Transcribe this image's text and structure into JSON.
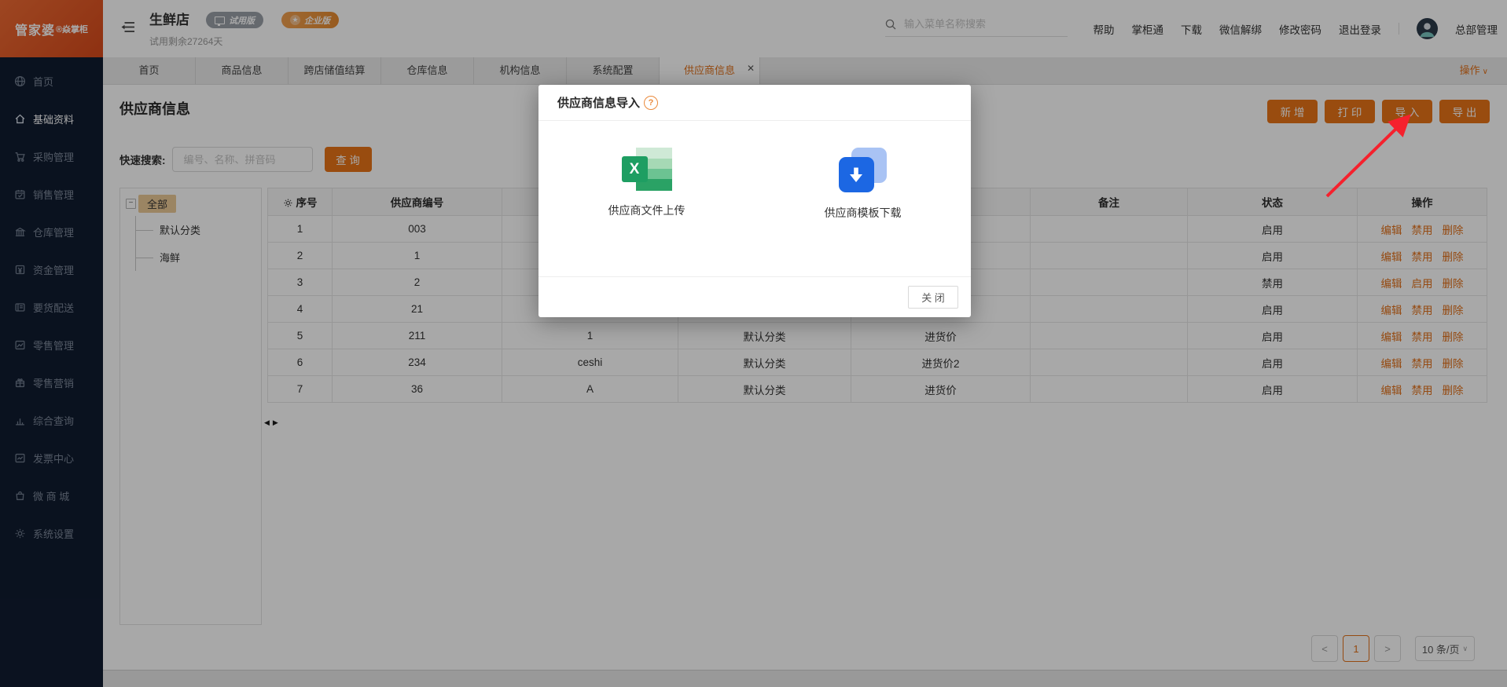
{
  "colors": {
    "accent_orange": "#e2711a",
    "button_orange": "#e87418",
    "sidebar_bg": "#101c30",
    "logo_orange": "#e05a24",
    "excel_green": "#1e9e62",
    "download_blue": "#1c67e3",
    "arrow_red": "#f5212d",
    "tree_highlight": "#ecca96"
  },
  "logo": {
    "brand": "管家婆",
    "product": "®焱掌柜"
  },
  "topbar": {
    "store_name": "生鲜店",
    "trial_badge": "试用版",
    "enterprise_badge": "企业版",
    "trial_remaining": "试用剩余27264天",
    "search_placeholder": "输入菜单名称搜索",
    "links": [
      {
        "label": "帮助"
      },
      {
        "label": "掌柜通"
      },
      {
        "label": "下载"
      },
      {
        "label": "微信解绑"
      },
      {
        "label": "修改密码"
      },
      {
        "label": "退出登录"
      }
    ],
    "user_name": "总部管理"
  },
  "sidebar": {
    "items": [
      {
        "label": "首页",
        "icon": "globe-icon"
      },
      {
        "label": "基础资料",
        "icon": "home-icon",
        "active": true
      },
      {
        "label": "采购管理",
        "icon": "cart-icon"
      },
      {
        "label": "销售管理",
        "icon": "calendar-icon"
      },
      {
        "label": "仓库管理",
        "icon": "warehouse-icon"
      },
      {
        "label": "资金管理",
        "icon": "money-icon"
      },
      {
        "label": "要货配送",
        "icon": "delivery-icon"
      },
      {
        "label": "零售管理",
        "icon": "retail-chart-icon"
      },
      {
        "label": "零售营销",
        "icon": "gift-icon"
      },
      {
        "label": "综合查询",
        "icon": "bar-chart-icon"
      },
      {
        "label": "发票中心",
        "icon": "invoice-icon"
      },
      {
        "label": "微 商 城",
        "icon": "mall-icon"
      },
      {
        "label": "系统设置",
        "icon": "gear-icon"
      }
    ]
  },
  "tabs": {
    "items": [
      {
        "label": "首页"
      },
      {
        "label": "商品信息"
      },
      {
        "label": "跨店储值结算"
      },
      {
        "label": "仓库信息"
      },
      {
        "label": "机构信息"
      },
      {
        "label": "系统配置"
      },
      {
        "label": "供应商信息",
        "active": true
      }
    ],
    "more_label": "操作"
  },
  "page": {
    "title": "供应商信息",
    "action_buttons": [
      {
        "label": "新 增"
      },
      {
        "label": "打 印"
      },
      {
        "label": "导 入"
      },
      {
        "label": "导 出"
      }
    ],
    "quick_search": {
      "label": "快速搜索:",
      "placeholder": "编号、名称、拼音码",
      "query_label": "查 询"
    },
    "tree": {
      "root": "全部",
      "children": [
        {
          "label": "默认分类"
        },
        {
          "label": "海鲜"
        }
      ]
    },
    "table": {
      "columns": [
        "序号",
        "供应商编号",
        "",
        "",
        "",
        "备注",
        "状态",
        "操作"
      ],
      "rows": [
        {
          "seq": "1",
          "code": "003",
          "name": "",
          "category": "",
          "price": "",
          "note": "",
          "status": "启用",
          "actions": [
            {
              "label": "编辑"
            },
            {
              "label": "禁用"
            },
            {
              "label": "删除"
            }
          ]
        },
        {
          "seq": "2",
          "code": "1",
          "name": "",
          "category": "",
          "price": "",
          "note": "",
          "status": "启用",
          "actions": [
            {
              "label": "编辑"
            },
            {
              "label": "禁用"
            },
            {
              "label": "删除"
            }
          ]
        },
        {
          "seq": "3",
          "code": "2",
          "name": "",
          "category": "",
          "price": "",
          "note": "",
          "status": "禁用",
          "actions": [
            {
              "label": "编辑"
            },
            {
              "label": "启用"
            },
            {
              "label": "删除"
            }
          ]
        },
        {
          "seq": "4",
          "code": "21",
          "name": "",
          "category": "",
          "price": "",
          "note": "",
          "status": "启用",
          "actions": [
            {
              "label": "编辑"
            },
            {
              "label": "禁用"
            },
            {
              "label": "删除"
            }
          ]
        },
        {
          "seq": "5",
          "code": "211",
          "name": "1",
          "category": "默认分类",
          "price": "进货价",
          "note": "",
          "status": "启用",
          "actions": [
            {
              "label": "编辑"
            },
            {
              "label": "禁用"
            },
            {
              "label": "删除"
            }
          ]
        },
        {
          "seq": "6",
          "code": "234",
          "name": "ceshi",
          "category": "默认分类",
          "price": "进货价2",
          "note": "",
          "status": "启用",
          "actions": [
            {
              "label": "编辑"
            },
            {
              "label": "禁用"
            },
            {
              "label": "删除"
            }
          ]
        },
        {
          "seq": "7",
          "code": "36",
          "name": "A",
          "category": "默认分类",
          "price": "进货价",
          "note": "",
          "status": "启用",
          "actions": [
            {
              "label": "编辑"
            },
            {
              "label": "禁用"
            },
            {
              "label": "删除"
            }
          ]
        }
      ]
    },
    "pager": {
      "prev": "<",
      "current": "1",
      "next": ">",
      "page_size": "10 条/页"
    }
  },
  "modal": {
    "title": "供应商信息导入",
    "upload_label": "供应商文件上传",
    "download_label": "供应商模板下载",
    "close_label": "关 闭"
  }
}
